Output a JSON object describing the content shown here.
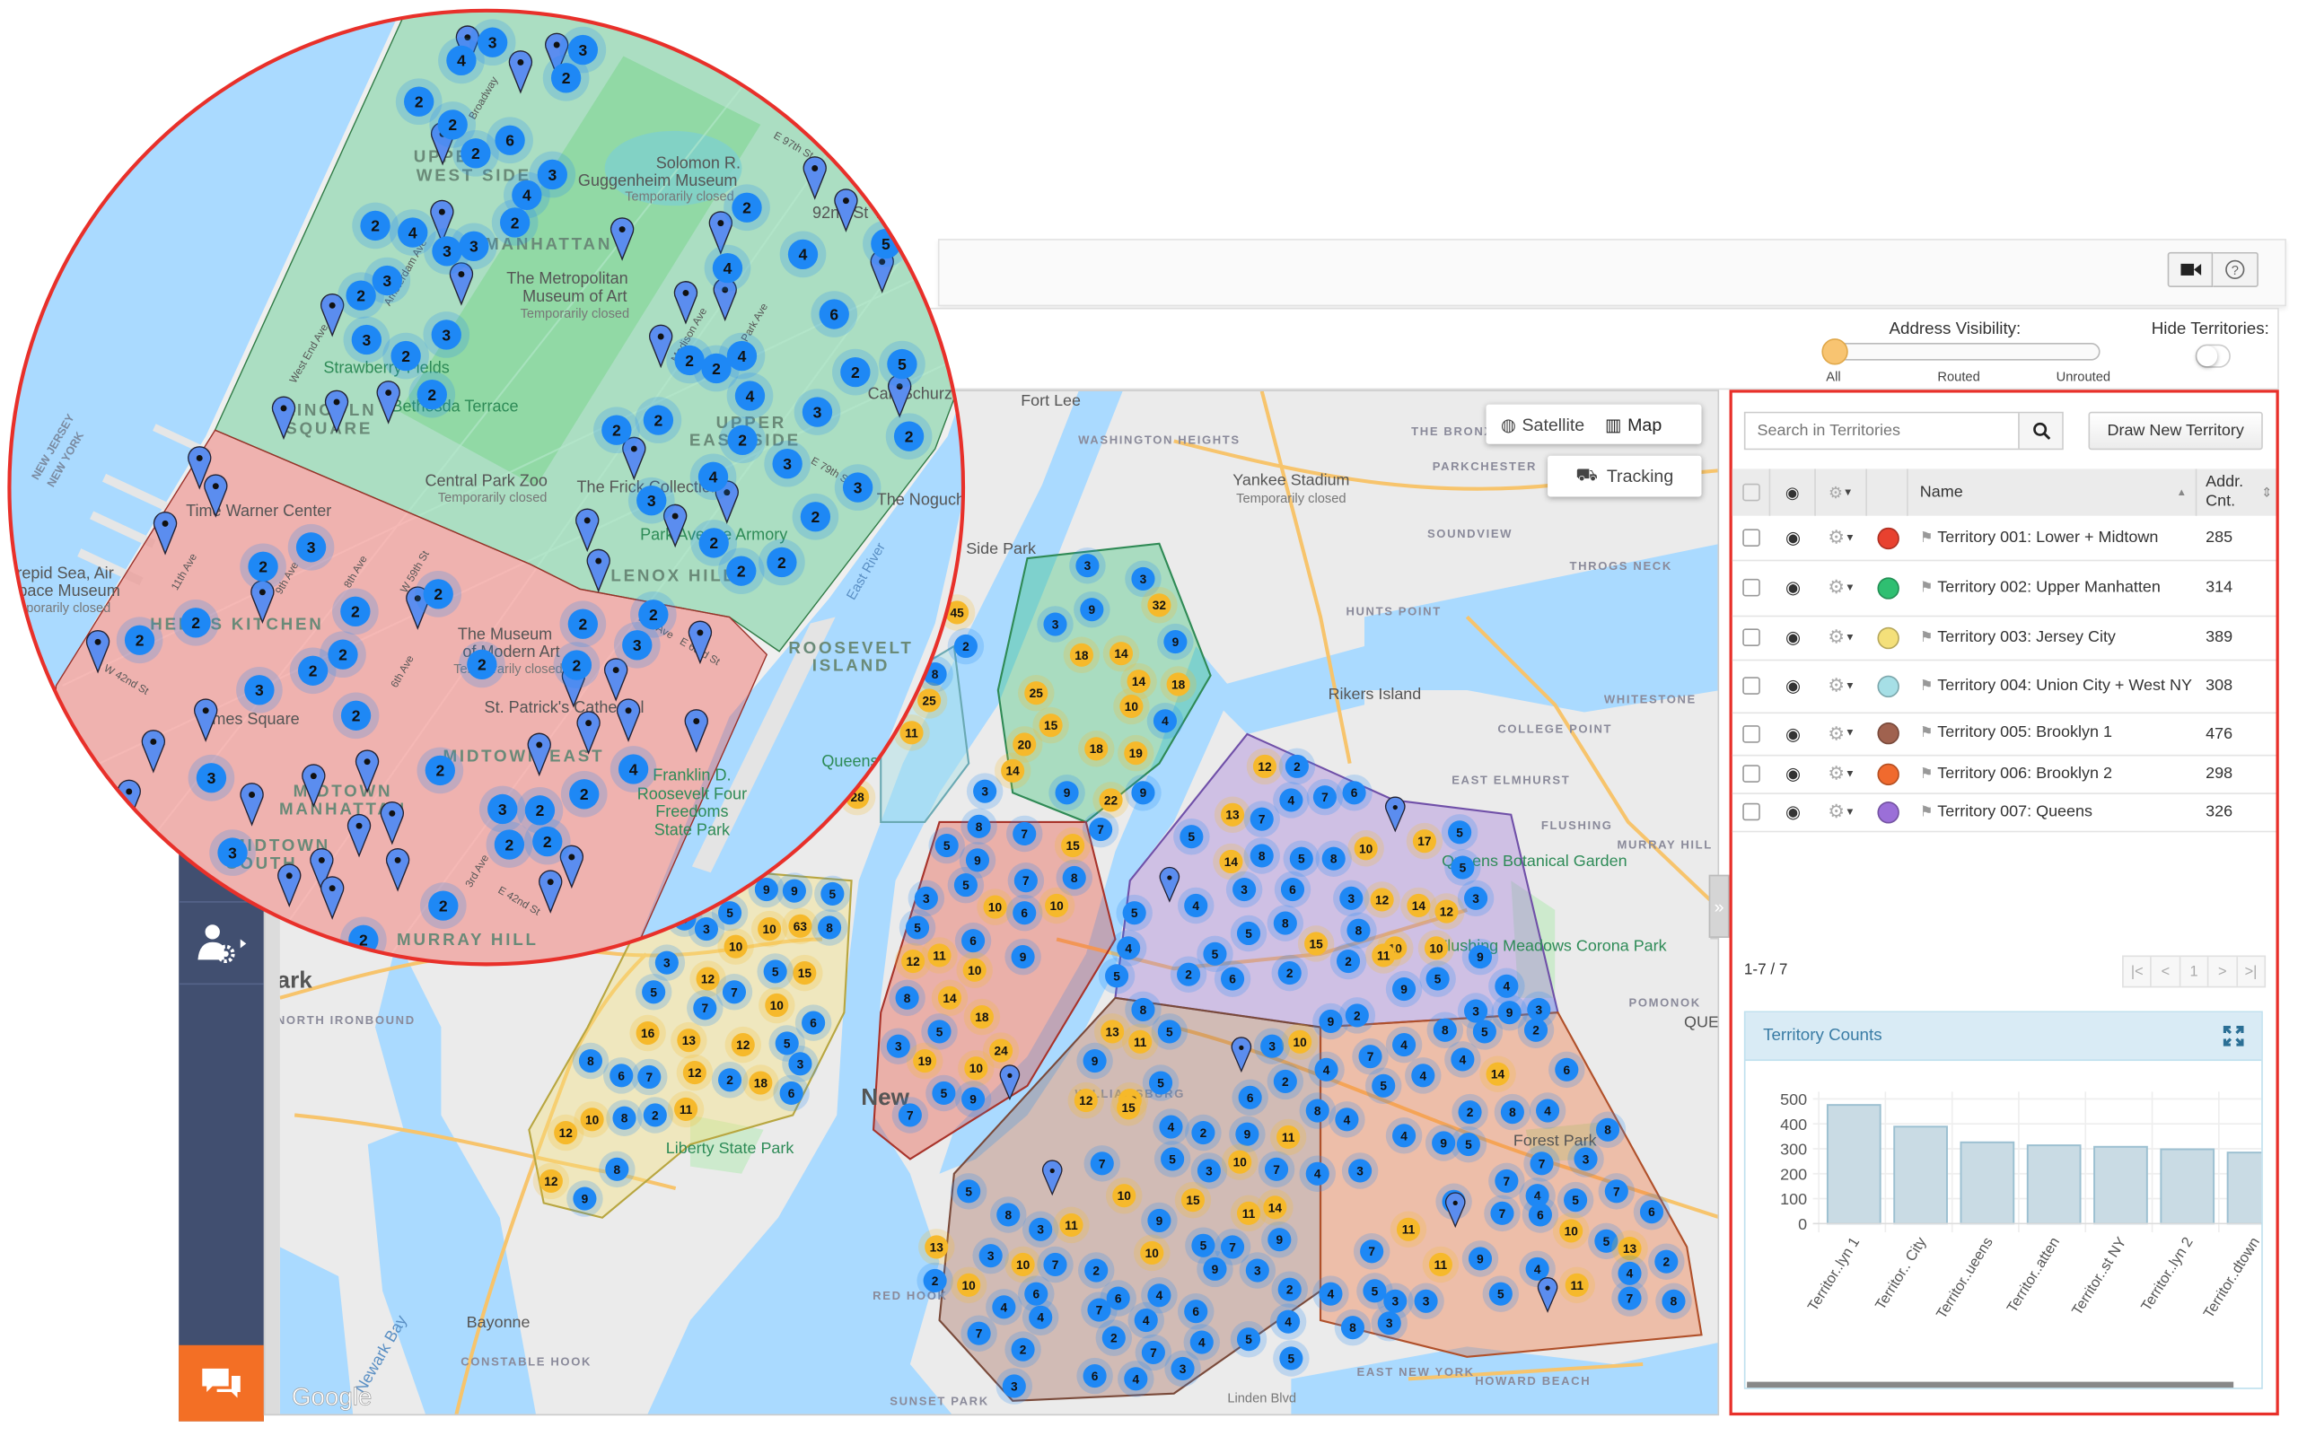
{
  "header": {
    "video_icon": "video-camera-icon",
    "help_icon": "question-circle-icon"
  },
  "toolbar": {
    "address_visibility_label": "Address Visibility:",
    "visibility_options": [
      "All",
      "Routed",
      "Unrouted"
    ],
    "visibility_selected": "All",
    "hide_territories_label": "Hide Territories:",
    "hide_territories_on": false
  },
  "map": {
    "type_buttons": {
      "satellite": "Satellite",
      "map": "Map"
    },
    "tracking": "Tracking",
    "google_logo": "Google",
    "labels": [
      "Fort Lee",
      "WASHINGTON HEIGHTS",
      "THE BRONX",
      "Yankee Stadium",
      "Temporarily closed",
      "PARKCHESTER",
      "SOUNDVIEW",
      "HUNTS POINT",
      "THROGS NECK",
      "Rikers Island",
      "WHITESTONE",
      "COLLEGE POINT",
      "EAST ELMHURST",
      "FLUSHING",
      "Queens Botanical Garden",
      "Flushing Meadows Corona Park",
      "MURRAY HILL",
      "POMONOK",
      "QUE",
      "Forest Park",
      "WILLIAMSBURG",
      "New",
      "RED HOOK",
      "SUNSET PARK",
      "EAST NEW YORK",
      "HOWARD BEACH",
      "Linden Blvd",
      "Liberty State Park",
      "Bayonne",
      "CONSTABLE HOOK",
      "NORTH IRONBOUND",
      "ark",
      "Newark Bay",
      "Side Park"
    ],
    "clusters": [
      3,
      3,
      32,
      9,
      3,
      9,
      18,
      14,
      14,
      18,
      25,
      10,
      15,
      4,
      20,
      18,
      19,
      14,
      9,
      22,
      9,
      3,
      7,
      45,
      2,
      8,
      25,
      11,
      28,
      5,
      8,
      7,
      15,
      9,
      5,
      7,
      8,
      3,
      10,
      6,
      10,
      5,
      6,
      11,
      9,
      12,
      10,
      8,
      14,
      18,
      5,
      3,
      19,
      24,
      10,
      5,
      9,
      7,
      9,
      9,
      5,
      63,
      8,
      5,
      3,
      3,
      10,
      10,
      15,
      5,
      10,
      3,
      12,
      7,
      5,
      7,
      6,
      16,
      13,
      12,
      5,
      12,
      3,
      8,
      7,
      6,
      2,
      18,
      6,
      8,
      2,
      11,
      10,
      12,
      8,
      12,
      9,
      12,
      2,
      4,
      7,
      6,
      13,
      7,
      5,
      17,
      5,
      14,
      8,
      5,
      8,
      10,
      5,
      3,
      6,
      3,
      12,
      14,
      12,
      5,
      4,
      3,
      5,
      8,
      8,
      4,
      5,
      15,
      10,
      10,
      9,
      2,
      11,
      5,
      2,
      6,
      2,
      5,
      4,
      9,
      3,
      9,
      3,
      8,
      5,
      13,
      11,
      3,
      10,
      9,
      2,
      9,
      4,
      7,
      4,
      8,
      5,
      2,
      5,
      12,
      6,
      2,
      5,
      4,
      4,
      14,
      12,
      15,
      4,
      2,
      9,
      11,
      8,
      4,
      4,
      9,
      2,
      8,
      4,
      6,
      7,
      5,
      3,
      10,
      7,
      4,
      3,
      5,
      8,
      3,
      7,
      7,
      4,
      5,
      10,
      15,
      11,
      14,
      3,
      7,
      6,
      5,
      7,
      6,
      8,
      3,
      11,
      9,
      5,
      7,
      9,
      11,
      10,
      5,
      13,
      13,
      3,
      10,
      7,
      2,
      10,
      9,
      3,
      7,
      11,
      9,
      4,
      2,
      2,
      10,
      6,
      6,
      4,
      2,
      4,
      5,
      3,
      3,
      5,
      11,
      7,
      8,
      4,
      4,
      4,
      7,
      4,
      6,
      4,
      8,
      3,
      7,
      2,
      2,
      7,
      4,
      5,
      5,
      3,
      6,
      4,
      3
    ]
  },
  "magnifier": {
    "labels": [
      "UPPER",
      "WEST SIDE",
      "MANHATTAN",
      "Solomon R.",
      "Guggenheim Museum",
      "Temporarily closed",
      "The Metropolitan",
      "Museum of Art",
      "Temporarily closed",
      "Strawberry Fields",
      "Bethesda Terrace",
      "LINCOLN",
      "SQUARE",
      "Central Park Zoo",
      "Temporarily closed",
      "The Frick Collection",
      "Park Avenue Armory",
      "UPPER",
      "EAST SIDE",
      "LENOX HILL",
      "Time Warner Center",
      "HELL'S KITCHEN",
      "The Museum",
      "of Modern Art",
      "Temporarily closed",
      "St. Patrick's Cathedral",
      "Times Square",
      "MIDTOWN EAST",
      "MIDTOWN",
      "MANHATTAN",
      "MIDTOWN",
      "SOUTH",
      "MURRAY HILL",
      "ROOSEVELT",
      "ISLAND",
      "East River",
      "Franklin D.",
      "Roosevelt Four",
      "Freedoms",
      "State Park",
      "NEW JERSEY",
      "NEW YORK",
      "Intrepid Sea, Air",
      "& Space Museum",
      "Temporarily closed",
      "W 42nd St",
      "E 42nd St",
      "Park Ave",
      "Broadway",
      "Amsterdam Ave",
      "West End Ave",
      "11th Ave",
      "9th Ave",
      "8th Ave",
      "6th Ave",
      "3rd Ave",
      "2nd Ave",
      "Madison Ave",
      "E 63rd St",
      "W 59th St",
      "E 79th St",
      "E 97th St",
      "92nd St Y",
      "The Noguchi",
      "Carl Schurz Park",
      "Queensbridge Park"
    ],
    "clusters": [
      3,
      4,
      3,
      2,
      2,
      2,
      6,
      2,
      3,
      4,
      2,
      2,
      4,
      3,
      3,
      3,
      2,
      3,
      3,
      2,
      2,
      2,
      4,
      4,
      5,
      6,
      2,
      2,
      4,
      4,
      5,
      2,
      3,
      2,
      2,
      2,
      2,
      3,
      4,
      3,
      2,
      3,
      2,
      2,
      2,
      3,
      2,
      2,
      2,
      2,
      2,
      2,
      2,
      3,
      2,
      2,
      2,
      2,
      2,
      3,
      4,
      2,
      2,
      3,
      3,
      2,
      2,
      2,
      3,
      2,
      2,
      2
    ]
  },
  "sidebar": {
    "items": [
      {
        "icon": "user-settings-icon"
      }
    ],
    "chat_icon": "chat-bubbles-icon"
  },
  "panel": {
    "search_placeholder": "Search in Territories",
    "search_value": "",
    "draw_button": "Draw New Territory",
    "columns": {
      "name": "Name",
      "count": "Addr. Cnt."
    },
    "territories": [
      {
        "name": "Territory 001: Lower + Midtown",
        "count": "285",
        "color": "#e8412f",
        "visible": true
      },
      {
        "name": "Territory 002: Upper Manhatten",
        "count": "314",
        "color": "#2fbf71",
        "visible": true
      },
      {
        "name": "Territory 003: Jersey City",
        "count": "389",
        "color": "#f4e07a",
        "visible": true
      },
      {
        "name": "Territory 004: Union City + West NY",
        "count": "308",
        "color": "#a6dfe6",
        "visible": true
      },
      {
        "name": "Territory 005: Brooklyn 1",
        "count": "476",
        "color": "#a0624f",
        "visible": true
      },
      {
        "name": "Territory 006: Brooklyn 2",
        "count": "298",
        "color": "#f06a2e",
        "visible": true
      },
      {
        "name": "Territory 007: Queens",
        "count": "326",
        "color": "#9b6fd8",
        "visible": true
      }
    ],
    "pagination": {
      "summary": "1-7 / 7",
      "first": "|<",
      "prev": "<",
      "page": "1",
      "next": ">",
      "last": ">|"
    }
  },
  "chart_data": {
    "type": "bar",
    "title": "Territory Counts",
    "categories": [
      "Territor..lyn 1",
      "Territor.. City",
      "Territor..ueens",
      "Territor..atten",
      "Territor..st NY",
      "Territor..lyn 2",
      "Territor..dtown"
    ],
    "values": [
      476,
      389,
      326,
      314,
      308,
      298,
      285
    ],
    "ylim": [
      0,
      500
    ],
    "yticks": [
      0,
      100,
      200,
      300,
      400,
      500
    ],
    "grid": true,
    "bar_color": "#c9dbe4",
    "bar_edge": "#9cc0d1"
  },
  "colors": {
    "highlight_border": "#e8302a",
    "sidebar": "#414f70",
    "chat": "#f36f25",
    "cluster_blue": "#1e88f5",
    "cluster_yellow": "#f6b92b",
    "slider_knob": "#f8c471"
  }
}
